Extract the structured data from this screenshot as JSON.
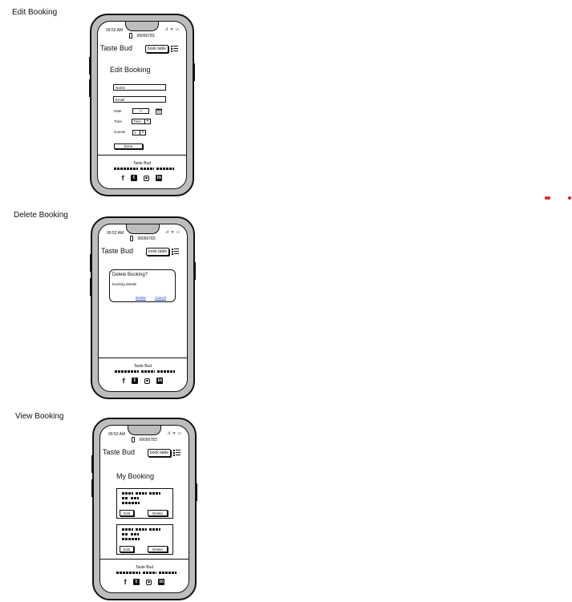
{
  "labels": {
    "edit": "Edit Booking",
    "delete": "Delete Booking",
    "view": "View Booking"
  },
  "status": {
    "time": "09:52 AM",
    "icons": ".ıl ᯤ ▭",
    "device_id": "99056783"
  },
  "header": {
    "brand": "Taste Bud",
    "book_button": "book table"
  },
  "edit_form": {
    "title": "Edit Booking",
    "name_placeholder": "Name",
    "email_placeholder": "Email",
    "date_label": "Date",
    "date_value": "/ /",
    "time_label": "Time",
    "time_value": "Time",
    "time_arrow": "▾",
    "guests_label": "Guests",
    "guests_value": "3",
    "stepper": "⇕",
    "done_button": "Done"
  },
  "delete_dialog": {
    "title": "Delete Booking?",
    "details": "booking details",
    "delete_link": "Delete",
    "cancel_link": "Cancel"
  },
  "view_page": {
    "title": "My Booking",
    "edit_button": "Edit",
    "delete_button": "Delete"
  },
  "footer": {
    "brand": "Taste Bud",
    "facebook": "f",
    "twitter": "t",
    "linkedin": "in"
  },
  "colors": {
    "phone_body": "#bdbdbd",
    "link": "#1a3fbf",
    "marker": "#e02020"
  },
  "icons": [
    "phone-icon",
    "signal-icon",
    "menu-icon",
    "calendar-icon",
    "facebook-icon",
    "twitter-icon",
    "instagram-icon",
    "linkedin-icon"
  ]
}
